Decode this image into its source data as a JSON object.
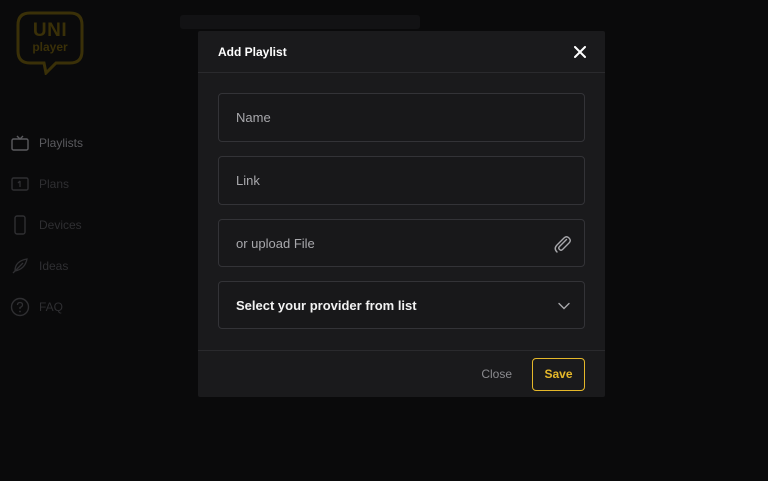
{
  "brand": {
    "line1": "UNI",
    "line2": "player"
  },
  "sidebar": {
    "items": [
      {
        "label": "Playlists",
        "icon": "tv-icon",
        "active": true
      },
      {
        "label": "Plans",
        "icon": "plans-icon",
        "active": false
      },
      {
        "label": "Devices",
        "icon": "phone-icon",
        "active": false
      },
      {
        "label": "Ideas",
        "icon": "feather-icon",
        "active": false
      },
      {
        "label": "FAQ",
        "icon": "question-icon",
        "active": false
      }
    ]
  },
  "modal": {
    "title": "Add Playlist",
    "close_icon": "close-icon",
    "fields": {
      "name": {
        "placeholder": "Name",
        "value": ""
      },
      "link": {
        "placeholder": "Link",
        "value": ""
      },
      "upload": {
        "placeholder": "or upload File",
        "value": "",
        "icon": "paperclip-icon"
      }
    },
    "provider_select": {
      "selected": "Select your provider from list",
      "icon": "chevron-down-icon"
    },
    "footer": {
      "close_label": "Close",
      "save_label": "Save"
    }
  },
  "colors": {
    "accent": "#e5b82a",
    "modal_bg": "#1a1a1c",
    "page_bg": "#0a0a0b"
  }
}
